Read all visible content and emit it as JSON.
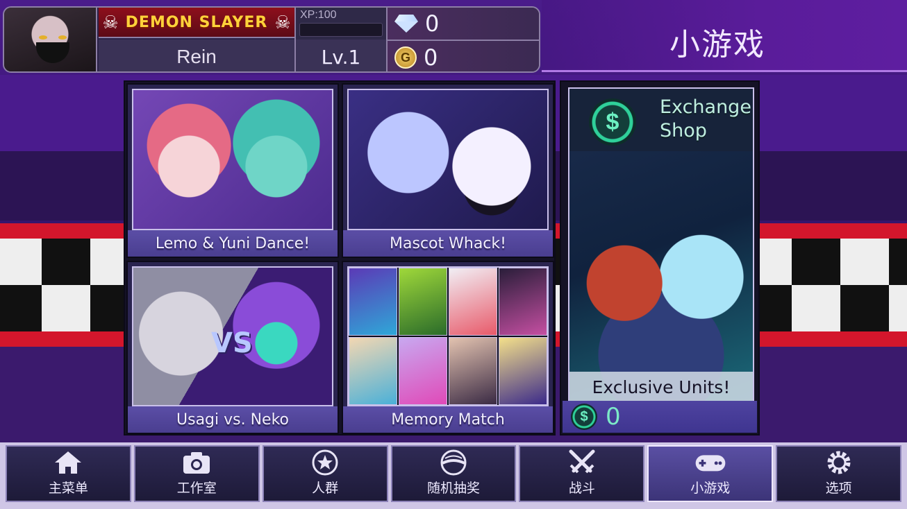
{
  "header": {
    "page_title": "小游戏",
    "player": {
      "title_banner": "DEMON SLAYER",
      "name": "Rein",
      "xp_label": "XP:100",
      "xp_progress": 0,
      "level": "Lv.1"
    },
    "currencies": {
      "diamonds": "0",
      "gold": "0",
      "gold_icon_letter": "G"
    }
  },
  "games": [
    {
      "label": "Lemo & Yuni Dance!"
    },
    {
      "label": "Mascot Whack!"
    },
    {
      "label": "Usagi vs. Neko",
      "art_text": "VS"
    },
    {
      "label": "Memory Match"
    }
  ],
  "exchange_shop": {
    "title": "Exchange Shop",
    "caption": "Exclusive Units!",
    "balance": "0",
    "coin_symbol": "$"
  },
  "nav": {
    "items": [
      {
        "label": "主菜单",
        "icon": "home-icon"
      },
      {
        "label": "工作室",
        "icon": "camera-icon"
      },
      {
        "label": "人群",
        "icon": "star-icon"
      },
      {
        "label": "随机抽奖",
        "icon": "gacha-icon"
      },
      {
        "label": "战斗",
        "icon": "swords-icon"
      },
      {
        "label": "小游戏",
        "icon": "gamepad-icon",
        "active": true
      },
      {
        "label": "选项",
        "icon": "gear-icon"
      }
    ]
  },
  "colors": {
    "background": "#3a1870",
    "accent_red": "#d3162c",
    "nav_active": "#5a4fa3",
    "shop_green": "#6cf0c2"
  }
}
